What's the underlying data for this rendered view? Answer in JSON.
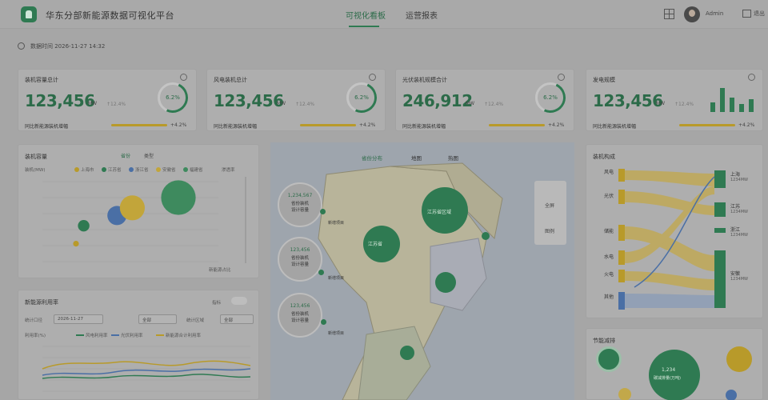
{
  "header": {
    "title": "华东分部新能源数据可视化平台",
    "nav": [
      "可视化看板",
      "运营报表"
    ],
    "user": "Admin",
    "exit": "退出"
  },
  "timestamp": "数据时间 2026-11-27 14:32",
  "kpis": [
    {
      "title": "装机容量总计",
      "value": "123,456",
      "unit": "MW",
      "sub": "↑12.4%",
      "ring_pct": "6.2%",
      "foot": "同比新能源装机增幅",
      "foot_value": "+4.2%"
    },
    {
      "title": "风电装机总计",
      "value": "123,456",
      "unit": "MW",
      "sub": "↑12.4%",
      "ring_pct": "6.2%",
      "foot": "同比新能源装机增幅",
      "foot_value": "+4.2%"
    },
    {
      "title": "光伏装机规模合计",
      "value": "246,912",
      "unit": "MW",
      "sub": "↑12.4%",
      "ring_pct": "6.2%",
      "foot": "同比新能源装机增幅",
      "foot_value": "+4.2%"
    },
    {
      "title": "发电规模",
      "value": "123,456",
      "unit": "MW",
      "sub": "↑12.4%",
      "foot": "同比新能源装机增幅",
      "foot_value": "+4.2%"
    }
  ],
  "capacity_panel": {
    "title": "装机容量",
    "toggles": [
      "省份",
      "类型"
    ],
    "unit": "装机(MW)",
    "legend": [
      "上海市",
      "江苏省",
      "浙江省",
      "安徽省",
      "福建省"
    ],
    "right_title": "渗透率",
    "right_foot": "新能源占比"
  },
  "chart_data": {
    "type": "scatter",
    "title": "装机容量",
    "series": [
      {
        "name": "上海市",
        "values": [
          [
            1,
            0.7,
            3
          ]
        ]
      },
      {
        "name": "江苏省",
        "values": [
          [
            1.3,
            1.4,
            6
          ]
        ]
      },
      {
        "name": "浙江省",
        "values": [
          [
            2.6,
            1.8,
            10
          ]
        ]
      },
      {
        "name": "安徽省",
        "values": [
          [
            3.2,
            2.1,
            13
          ]
        ]
      },
      {
        "name": "福建省",
        "values": [
          [
            5.0,
            2.5,
            18
          ]
        ]
      }
    ]
  },
  "trend_panel": {
    "title": "新能源利用率",
    "right_label": "指标",
    "filter_label": "统计口径",
    "filter_value": "2026-11-27",
    "filter2": "全部",
    "filter3_label": "统计区域",
    "filter3": "全部",
    "legend_unit": "利用率(%)",
    "legend": [
      "风电利用率",
      "光伏利用率",
      "新能源合计利用率"
    ]
  },
  "map_panel": {
    "tabs": [
      "省份分布",
      "地图",
      "热图"
    ],
    "ctrl": [
      "全屏",
      "图例"
    ],
    "gauges": [
      {
        "value": "1,234,567",
        "l1": "省份装机",
        "l2": "设计容量"
      },
      {
        "value": "123,456",
        "l1": "省份装机",
        "l2": "设计容量"
      },
      {
        "value": "123,456",
        "l1": "省份装机",
        "l2": "设计容量"
      }
    ],
    "pin_label": "新增项目",
    "regions": [
      "江苏省区域",
      "江苏省"
    ]
  },
  "sankey_panel": {
    "title": "装机构成",
    "left": [
      "风电",
      "光伏",
      "储能",
      "水电",
      "火电",
      "其他"
    ],
    "right": [
      "上海",
      "江苏",
      "浙江",
      "安徽"
    ],
    "right_values": [
      "1234MW",
      "1234MW",
      "1234MW",
      "1234MW"
    ]
  },
  "bottom_right": {
    "title": "节能减排",
    "center_value": "1,234",
    "center_label": "碳减排量(万吨)"
  },
  "colors": {
    "green": "#2f7a52",
    "gold": "#b89a2a",
    "blue": "#4a6fa5"
  }
}
